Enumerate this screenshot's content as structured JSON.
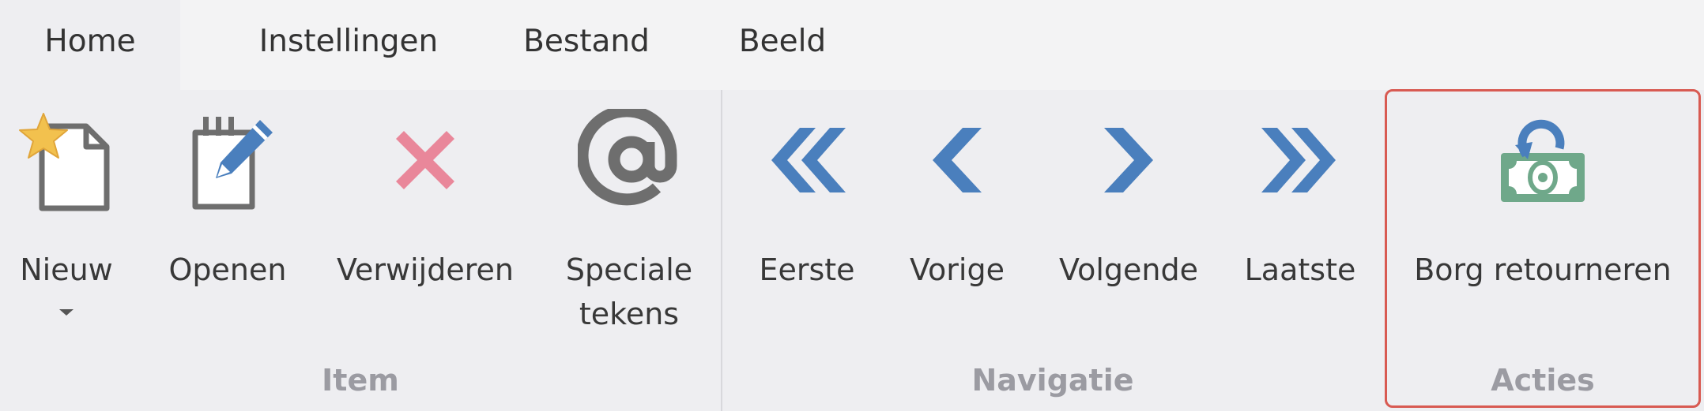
{
  "tabs": [
    {
      "label": "Home",
      "active": true
    },
    {
      "label": "Instellingen",
      "active": false
    },
    {
      "label": "Bestand",
      "active": false
    },
    {
      "label": "Beeld",
      "active": false
    }
  ],
  "groups": {
    "item": {
      "label": "Item",
      "buttons": {
        "nieuw": {
          "label": "Nieuw",
          "icon": "new-document-star-icon"
        },
        "openen": {
          "label": "Openen",
          "icon": "notepad-pencil-icon"
        },
        "verwijderen": {
          "label": "Verwijderen",
          "icon": "delete-x-icon"
        },
        "speciale_tekens": {
          "label": "Speciale\ntekens",
          "icon": "at-sign-icon"
        }
      }
    },
    "navigatie": {
      "label": "Navigatie",
      "buttons": {
        "eerste": {
          "label": "Eerste",
          "icon": "double-chevron-left-icon"
        },
        "vorige": {
          "label": "Vorige",
          "icon": "chevron-left-icon"
        },
        "volgende": {
          "label": "Volgende",
          "icon": "chevron-right-icon"
        },
        "laatste": {
          "label": "Laatste",
          "icon": "double-chevron-right-icon"
        }
      }
    },
    "acties": {
      "label": "Acties",
      "buttons": {
        "borg_retourneren": {
          "label": "Borg retourneren",
          "icon": "money-return-icon"
        }
      }
    }
  },
  "colors": {
    "nav_blue": "#4a7fbd",
    "delete_red": "#e9879a",
    "money_green": "#6fa88a",
    "star_gold": "#f2c14e",
    "icon_gray": "#6e6e6e",
    "highlight_border": "#d85a52"
  }
}
